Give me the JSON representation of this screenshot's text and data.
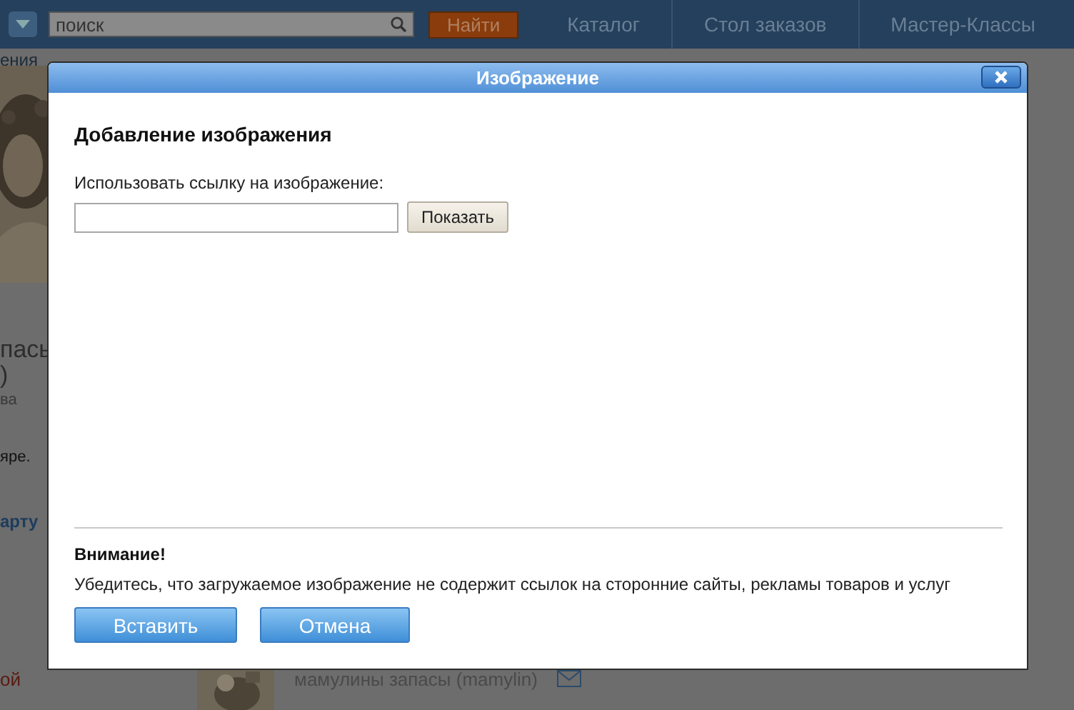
{
  "topbar": {
    "search": {
      "placeholder": "поиск"
    },
    "search_button": "Найти",
    "nav": [
      {
        "label": "Каталог"
      },
      {
        "label": "Стол заказов"
      },
      {
        "label": "Мастер-Классы"
      }
    ]
  },
  "background": {
    "breadcrumb": "ения",
    "left_texts": [
      {
        "kind": "title",
        "text": "пась"
      },
      {
        "kind": "title",
        "text": ")"
      },
      {
        "kind": "meta",
        "text": "ва"
      },
      {
        "kind": "body",
        "text": "яре."
      },
      {
        "kind": "link",
        "text": "арту"
      },
      {
        "kind": "alert",
        "text": "ой"
      }
    ],
    "feed_author": "мамулины запасы (mamylin)"
  },
  "dialog": {
    "title": "Изображение",
    "heading": "Добавление изображения",
    "url_label": "Использовать ссылку на изображение:",
    "show_button": "Показать",
    "warning_title": "Внимание!",
    "warning_text": "Убедитесь, что загружаемое изображение не содержит ссылок на сторонние сайты, рекламы товаров и услуг",
    "buttons": [
      {
        "label": "Вставить"
      },
      {
        "label": "Отмена"
      }
    ]
  }
}
